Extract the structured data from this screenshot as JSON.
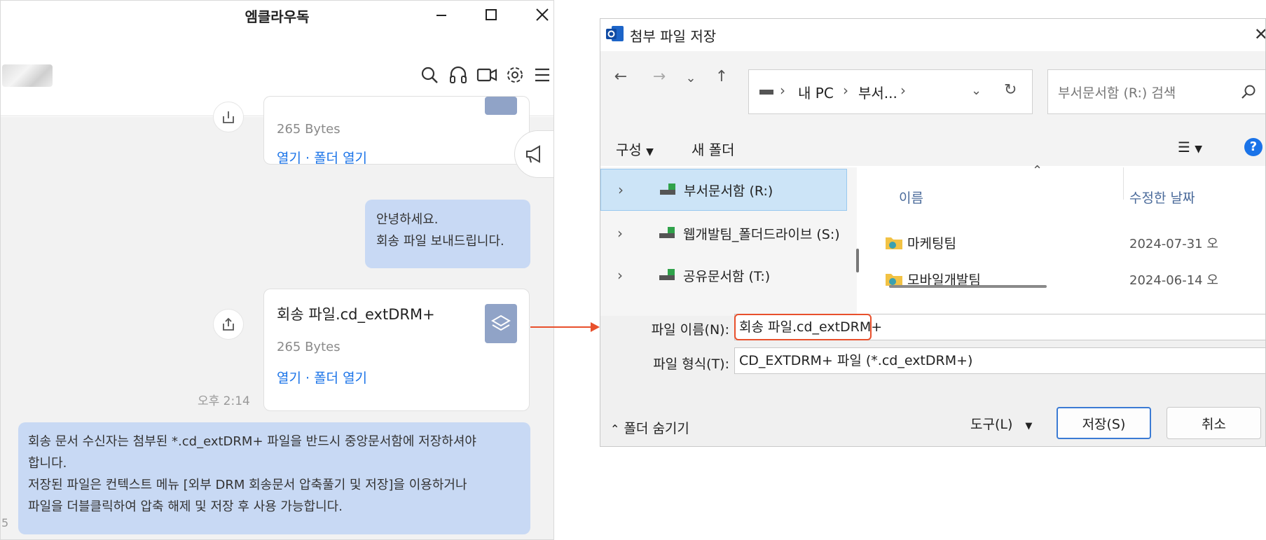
{
  "chat": {
    "title": "엠클라우독",
    "message_top": {
      "file_size": "265 Bytes",
      "open_links": "열기 · 폴더 열기"
    },
    "greeting": {
      "line1": "안녕하세요.",
      "line2": "회송 파일 보내드립니다."
    },
    "file_card": {
      "file_name": "회송 파일.cd_extDRM+",
      "file_size": "265 Bytes",
      "open_links": "열기 · 폴더 열기"
    },
    "timestamp": "오후 2:14",
    "notice": {
      "line1": "회송 문서 수신자는 첨부된 *.cd_extDRM+ 파일을 반드시 중앙문서함에 저장하셔야",
      "line2": "합니다.",
      "line3": "저장된 파일은 컨텍스트 메뉴 [외부 DRM 회송문서 압축풀기 및 저장]을 이용하거나",
      "line4": "파일을 더블클릭하여 압축 해제 및 저장 후 사용 가능합니다."
    },
    "left_edge_digit": "5"
  },
  "dialog": {
    "title": "첨부 파일 저장",
    "address": {
      "segments": [
        "내 PC",
        "부서..."
      ],
      "separator": "›"
    },
    "search_placeholder": "부서문서함 (R:) 검색",
    "commands": {
      "organize": "구성",
      "new_folder": "새 폴더"
    },
    "tree": [
      {
        "label": "부서문서함 (R:)",
        "selected": true
      },
      {
        "label": "웹개발팀_폴더드라이브 (S:)",
        "selected": false
      },
      {
        "label": "공유문서함 (T:)",
        "selected": false
      }
    ],
    "columns": {
      "name": "이름",
      "modified": "수정한 날짜"
    },
    "files": [
      {
        "name": "마케팅팀",
        "date": "2024-07-31 오"
      },
      {
        "name": "모바일개발팀",
        "date": "2024-06-14 오"
      }
    ],
    "form": {
      "filename_label": "파일 이름(N):",
      "filename_value": "회송 파일.cd_extDRM+",
      "filetype_label": "파일 형식(T):",
      "filetype_value": "CD_EXTDRM+ 파일 (*.cd_extDRM+)"
    },
    "footer": {
      "hide_folders": "폴더 숨기기",
      "tools": "도구(L)",
      "save": "저장(S)",
      "cancel": "취소"
    }
  },
  "colors": {
    "accent_link": "#1a73e8",
    "bubble": "#c8d9f4",
    "highlight": "#e8502c",
    "selected_tree": "#cce4f7"
  }
}
